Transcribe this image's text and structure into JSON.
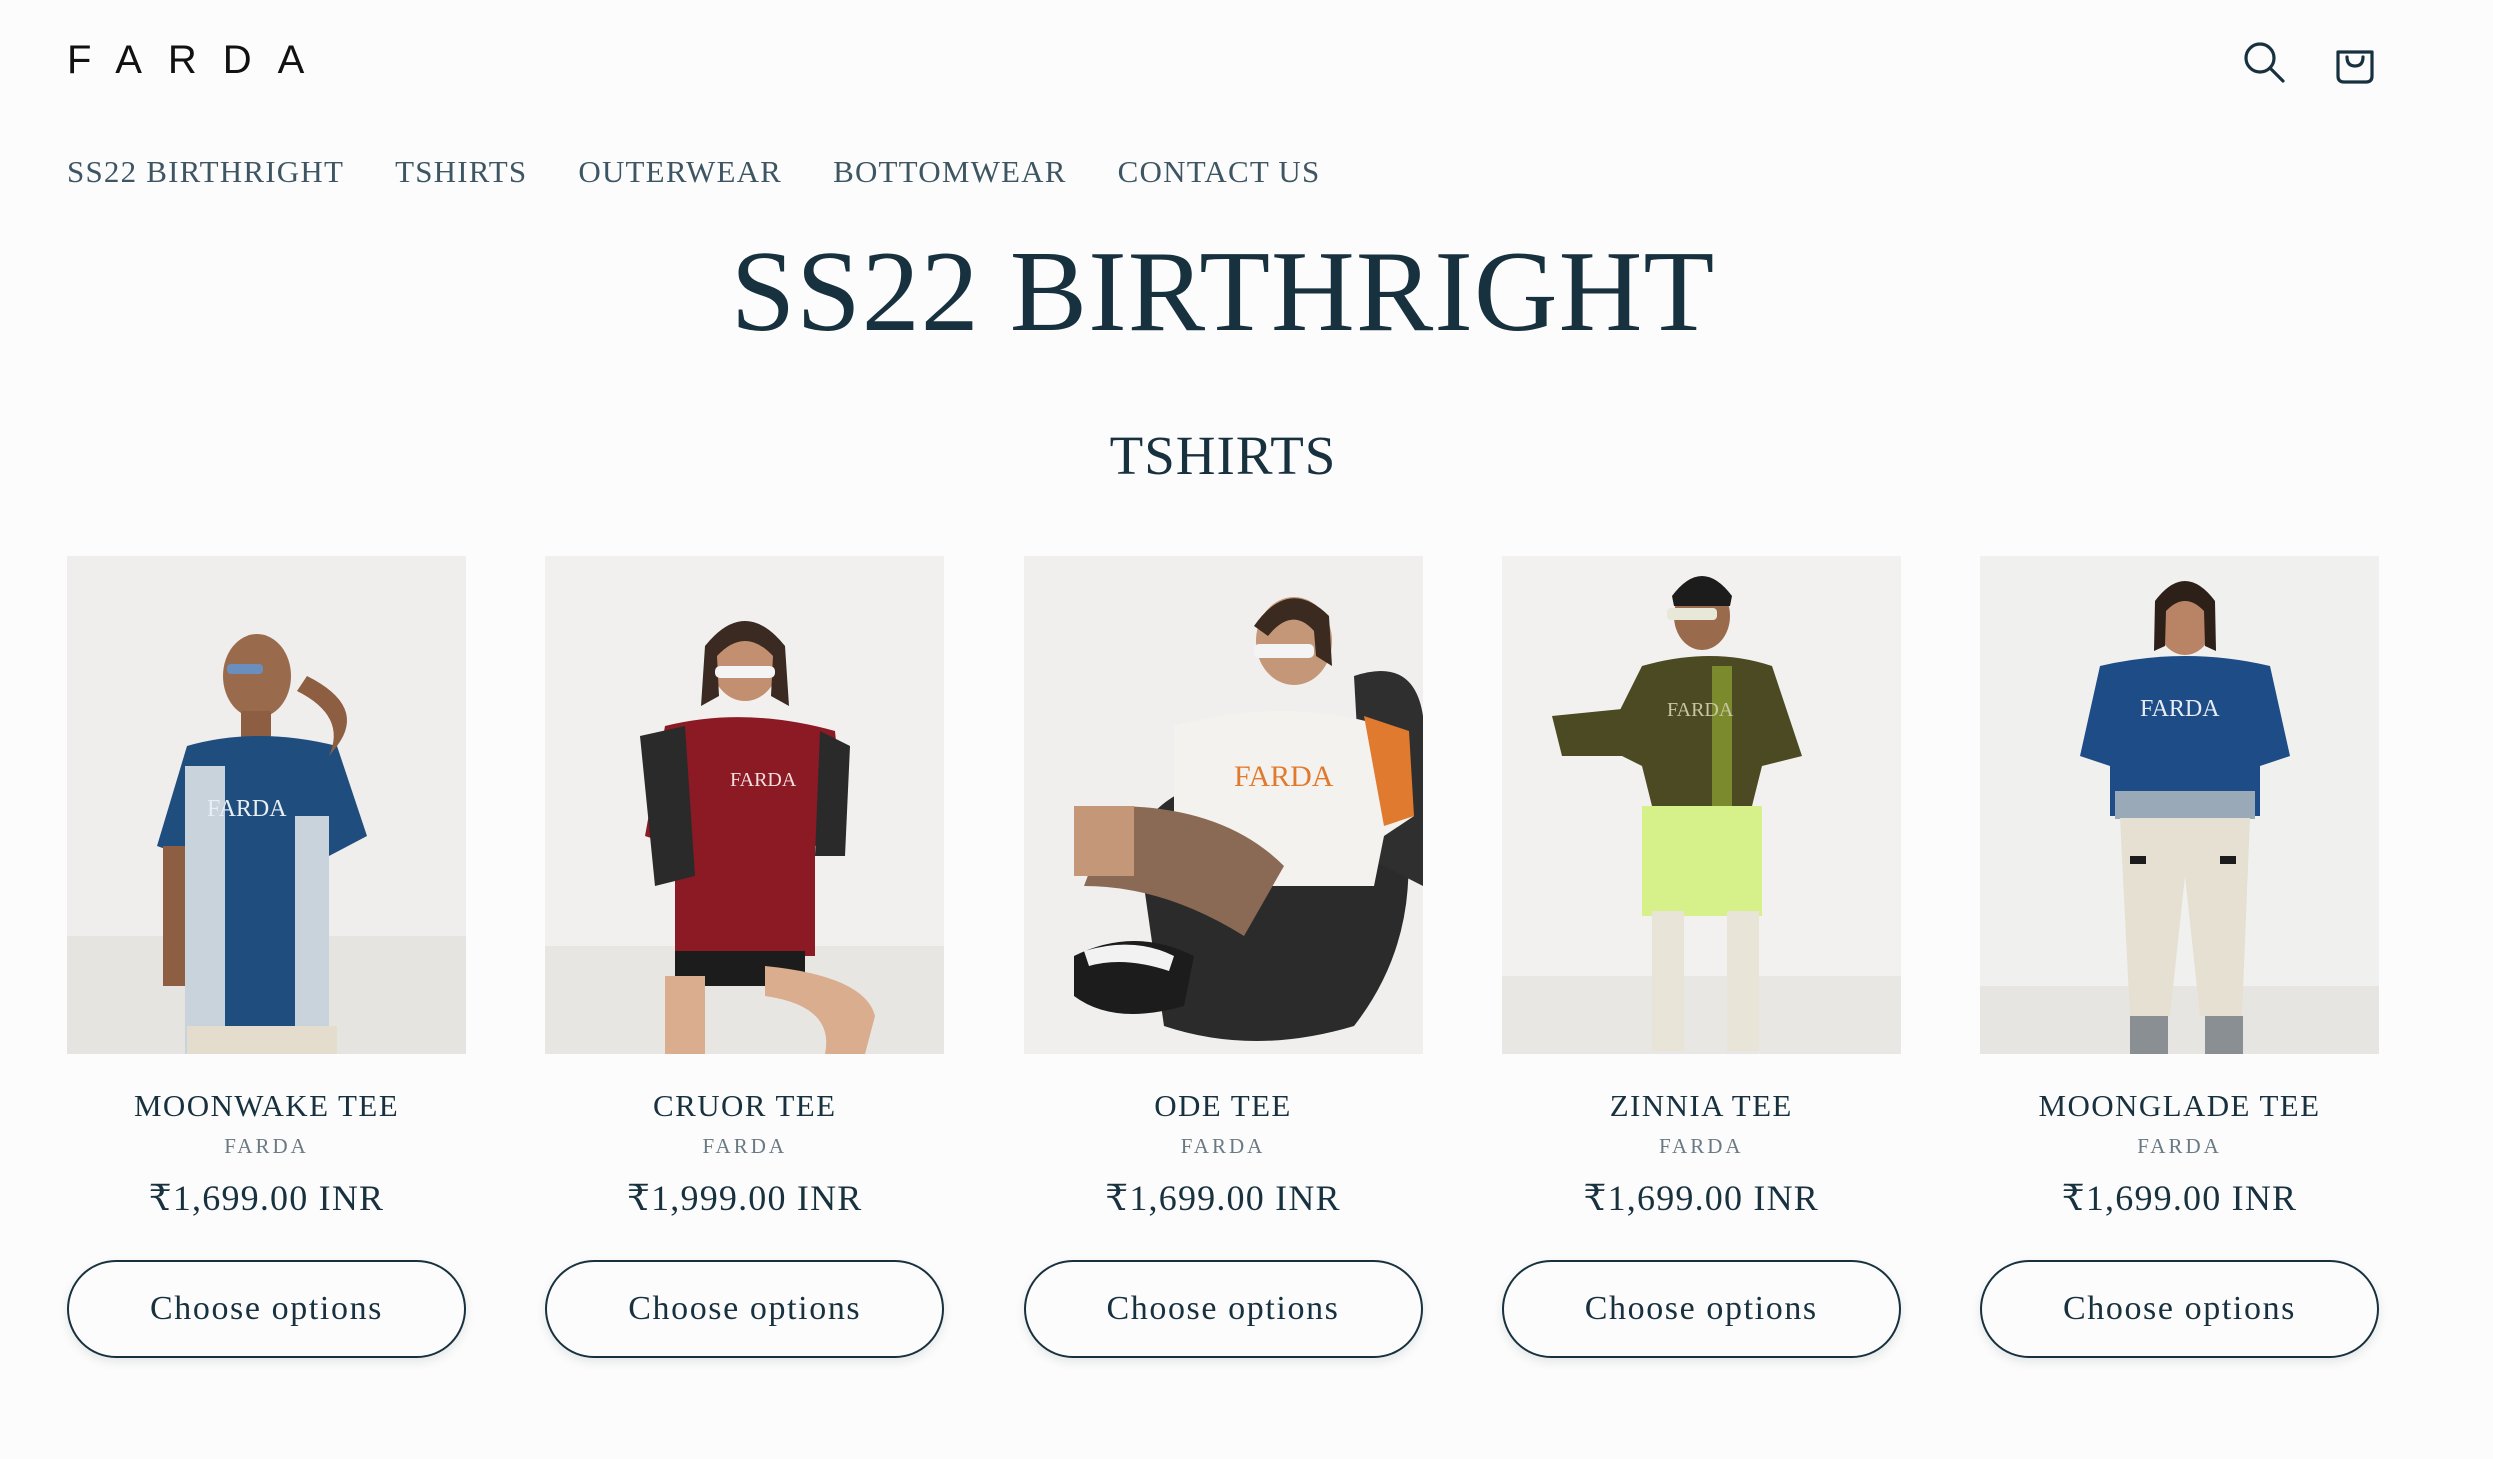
{
  "header": {
    "logo_text": "FARDA",
    "search_icon": "search-icon",
    "cart_icon": "cart-icon"
  },
  "nav": {
    "items": [
      {
        "label": "SS22 BIRTHRIGHT"
      },
      {
        "label": "TSHIRTS"
      },
      {
        "label": "OUTERWEAR"
      },
      {
        "label": "BOTTOMWEAR"
      },
      {
        "label": "CONTACT US"
      }
    ]
  },
  "main": {
    "title": "SS22 BIRTHRIGHT",
    "section_title": "TSHIRTS",
    "products": [
      {
        "name": "MOONWAKE TEE",
        "vendor": "FARDA",
        "price": "₹1,699.00 INR",
        "button": "Choose options",
        "shirt_color": "#1f4e7e",
        "accent_color": "#c9d3dc",
        "bottom_color": "#e4dccd"
      },
      {
        "name": "CRUOR TEE",
        "vendor": "FARDA",
        "price": "₹1,999.00 INR",
        "button": "Choose options",
        "shirt_color": "#8c1a24",
        "accent_color": "#2a2a2a",
        "bottom_color": "#1c1c1c"
      },
      {
        "name": "ODE TEE",
        "vendor": "FARDA",
        "price": "₹1,699.00 INR",
        "button": "Choose options",
        "shirt_color": "#f4f2ee",
        "accent_color": "#e07a2e",
        "bottom_color": "#8a6a55"
      },
      {
        "name": "ZINNIA TEE",
        "vendor": "FARDA",
        "price": "₹1,699.00 INR",
        "button": "Choose options",
        "shirt_color": "#4b4a22",
        "accent_color": "#7c8a2e",
        "bottom_color": "#d6f08a"
      },
      {
        "name": "MOONGLADE TEE",
        "vendor": "FARDA",
        "price": "₹1,699.00 INR",
        "button": "Choose options",
        "shirt_color": "#1e4c86",
        "accent_color": "#9aa9b8",
        "bottom_color": "#e6e0d2"
      }
    ]
  }
}
